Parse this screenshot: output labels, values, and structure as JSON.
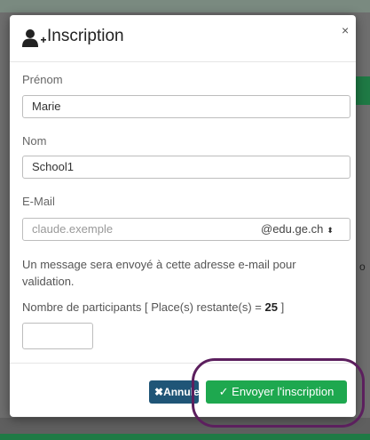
{
  "modal": {
    "title": "Inscription",
    "close_glyph": "×",
    "icon": "user-plus-icon"
  },
  "form": {
    "first_name_label": "Prénom",
    "first_name_value": "Marie",
    "last_name_label": "Nom",
    "last_name_value": "School1",
    "email_label": "E-Mail",
    "email_placeholder": "claude.exemple",
    "email_domain_selected": "@edu.ge.ch",
    "email_help": "Un message sera envoyé à cette adresse e-mail pour validation.",
    "participants_label_prefix": "Nombre de participants [ Place(s) restante(s) = ",
    "participants_remaining": "25",
    "participants_label_suffix": " ]",
    "participants_value": ""
  },
  "buttons": {
    "cancel_label": "Annuler",
    "cancel_icon": "x-icon",
    "submit_label": "Envoyer l'inscription",
    "submit_icon": "check-icon"
  },
  "background": {
    "right_edge_text": "o"
  },
  "colors": {
    "submit": "#1ea84f",
    "cancel": "#1f5577",
    "highlight": "#5c1f5e"
  }
}
